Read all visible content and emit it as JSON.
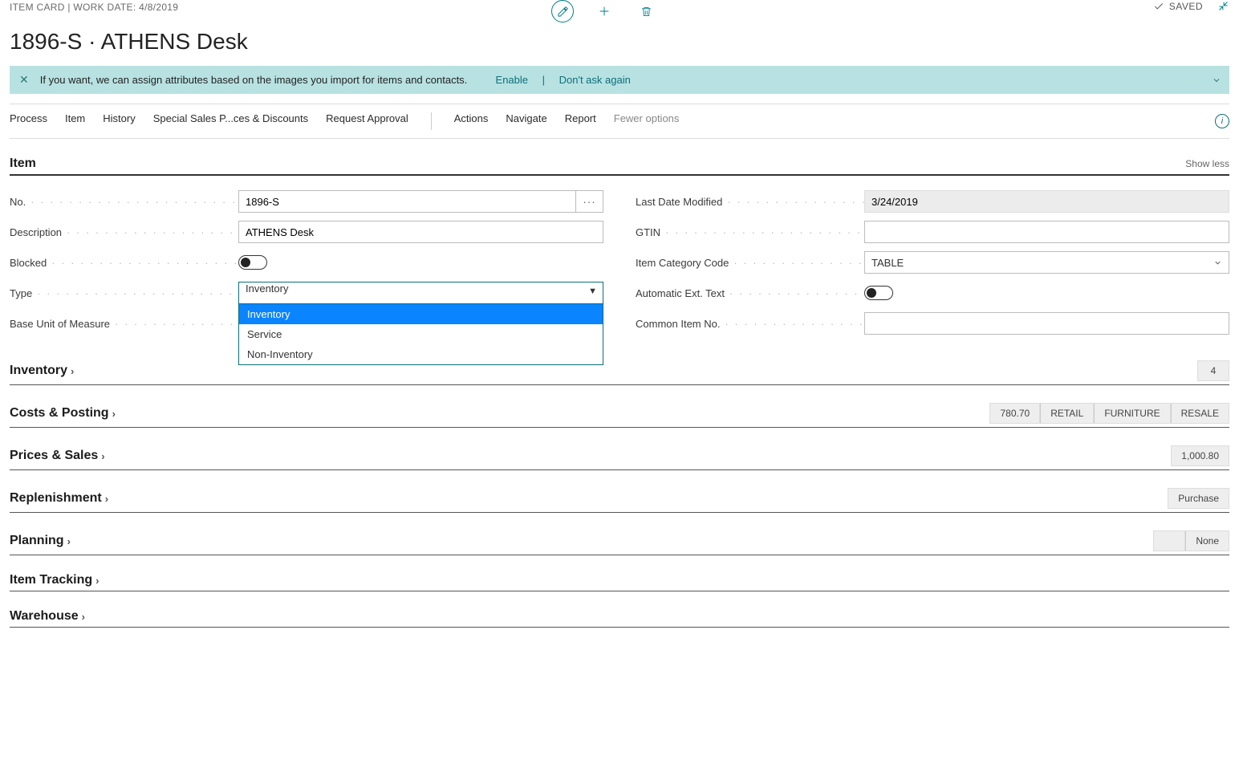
{
  "header": {
    "breadcrumb": "ITEM CARD | WORK DATE: 4/8/2019",
    "title": "1896-S · ATHENS Desk",
    "saved_label": "SAVED"
  },
  "notice": {
    "text": "If you want, we can assign attributes based on the images you import for items and contacts.",
    "enable": "Enable",
    "dont_ask": "Don't ask again"
  },
  "menu": {
    "process": "Process",
    "item": "Item",
    "history": "History",
    "special": "Special Sales P...ces & Discounts",
    "request_approval": "Request Approval",
    "actions": "Actions",
    "navigate": "Navigate",
    "report": "Report",
    "fewer": "Fewer options"
  },
  "sections": {
    "item": {
      "title": "Item",
      "show_less": "Show less"
    },
    "inventory": {
      "title": "Inventory",
      "badges": [
        "4"
      ]
    },
    "costs": {
      "title": "Costs & Posting",
      "badges": [
        "780.70",
        "RETAIL",
        "FURNITURE",
        "RESALE"
      ]
    },
    "prices": {
      "title": "Prices & Sales",
      "badges": [
        "1,000.80"
      ]
    },
    "replenishment": {
      "title": "Replenishment",
      "badges": [
        "Purchase"
      ]
    },
    "planning": {
      "title": "Planning",
      "badges": [
        "",
        "None"
      ]
    },
    "tracking": {
      "title": "Item Tracking",
      "badges": []
    },
    "warehouse": {
      "title": "Warehouse",
      "badges": []
    }
  },
  "fields": {
    "no_label": "No.",
    "no_value": "1896-S",
    "description_label": "Description",
    "description_value": "ATHENS Desk",
    "blocked_label": "Blocked",
    "type_label": "Type",
    "type_value": "Inventory",
    "type_options": [
      "Inventory",
      "Service",
      "Non-Inventory"
    ],
    "buom_label": "Base Unit of Measure",
    "last_date_label": "Last Date Modified",
    "last_date_value": "3/24/2019",
    "gtin_label": "GTIN",
    "gtin_value": "",
    "category_label": "Item Category Code",
    "category_value": "TABLE",
    "auto_ext_label": "Automatic Ext. Text",
    "common_no_label": "Common Item No.",
    "common_no_value": ""
  }
}
